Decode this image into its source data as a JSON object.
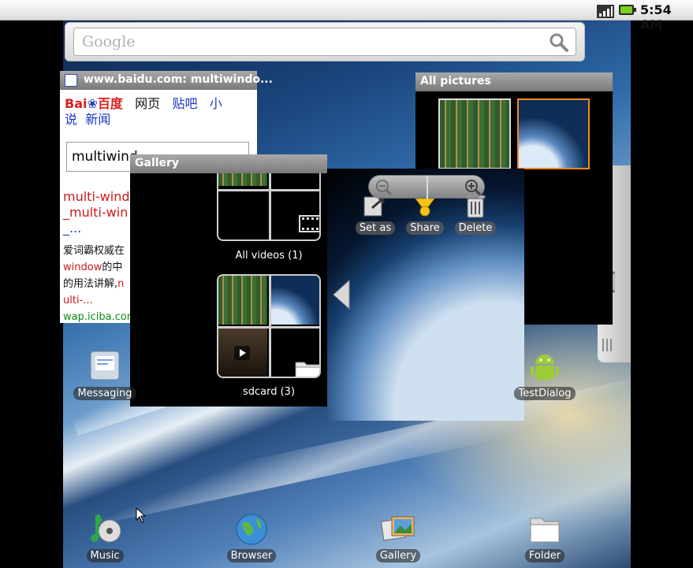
{
  "status_bar": {
    "time": "5:54 AM",
    "icons": [
      "signal-icon",
      "battery-icon"
    ]
  },
  "google_widget": {
    "placeholder": "Google",
    "icon": "search-icon"
  },
  "browser": {
    "title": "www.baidu.com: multiwindo...",
    "logo": "Bai",
    "logo_tail": "百度",
    "nav_links": [
      "网页",
      "贴吧",
      "小",
      "说",
      "新闻"
    ],
    "search_value": "multiwind",
    "result_title_1": "multi-winde",
    "result_title_2": "_multi-win",
    "result_title_3": "_...",
    "snippet_1": "爱词霸权威在",
    "snippet_2a": "window",
    "snippet_2b": "的中",
    "snippet_3a": "的用法讲解,",
    "snippet_3b": "n",
    "snippet_4": "ulti-...",
    "result_url": "wap.iciba.com"
  },
  "all_pictures": {
    "title": "All pictures",
    "thumbnails": [
      "circuit-board",
      "earth-from-space"
    ]
  },
  "gallery": {
    "title": "Gallery",
    "albums": [
      {
        "label": "All videos (1)",
        "icon": "film-icon"
      },
      {
        "label": "sdcard (3)",
        "icon": "folder-icon"
      }
    ]
  },
  "viewer": {
    "actions": [
      {
        "label": "Set as",
        "icon": "set-as-icon"
      },
      {
        "label": "Share",
        "icon": "share-icon"
      },
      {
        "label": "Delete",
        "icon": "trash-icon"
      }
    ]
  },
  "desktop": {
    "icons": [
      {
        "label": "Messaging",
        "icon": "messaging-icon"
      },
      {
        "label": "TestDialog",
        "icon": "android-icon"
      },
      {
        "label": "Music",
        "icon": "music-icon"
      },
      {
        "label": "Browser",
        "icon": "globe-icon"
      },
      {
        "label": "Gallery",
        "icon": "gallery-icon"
      },
      {
        "label": "Folder",
        "icon": "folder-icon"
      }
    ]
  },
  "colors": {
    "accent_orange": "#f28a1a",
    "baidu_red": "#d91e1e",
    "baidu_blue": "#2044b6",
    "link_blue": "#1a35c8"
  }
}
